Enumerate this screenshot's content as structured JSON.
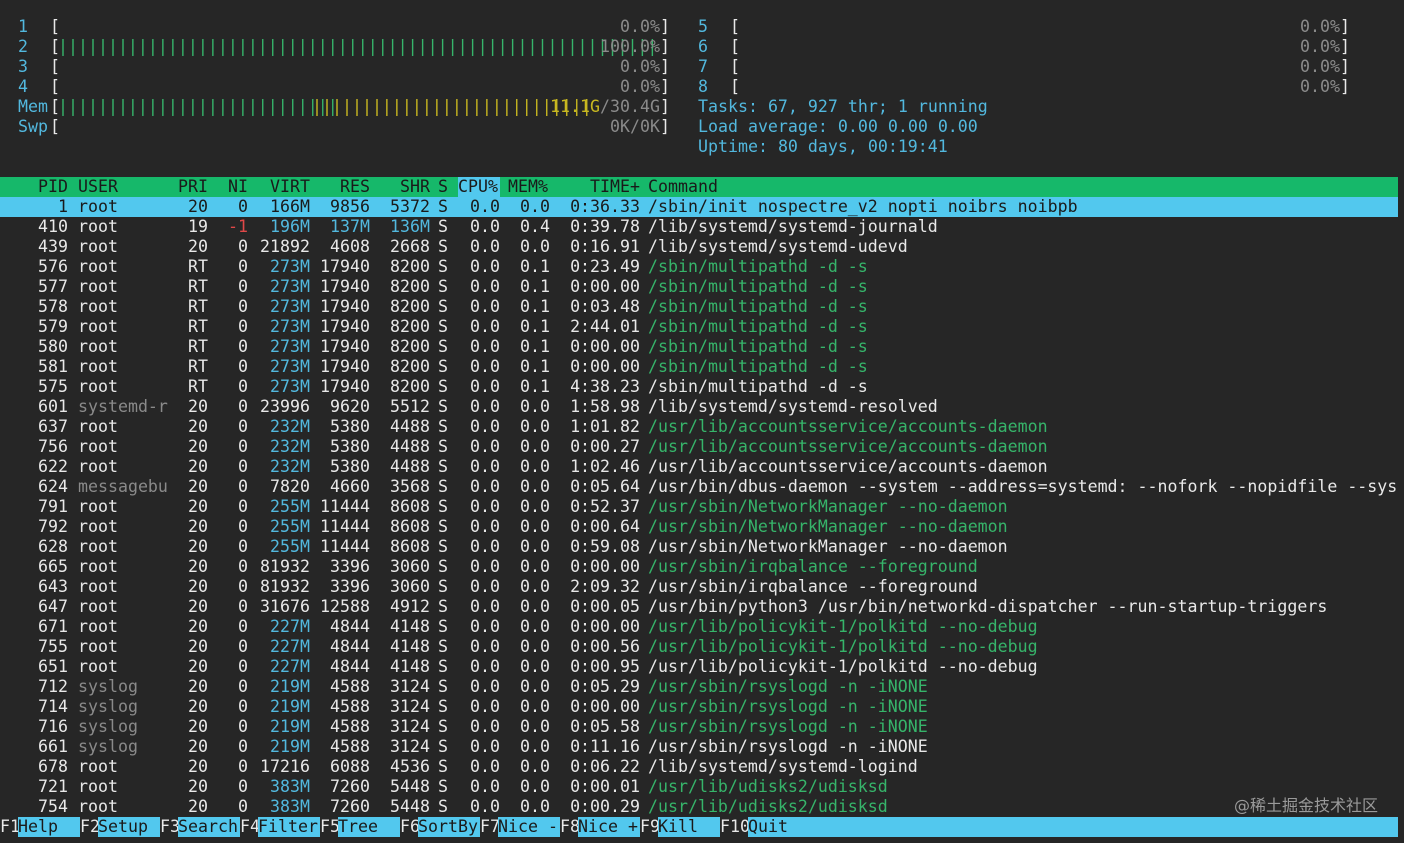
{
  "cpus_left": [
    {
      "num": "1",
      "bar": "",
      "pct": "0.0%"
    },
    {
      "num": "2",
      "bar": "||||||||||||||||||||||||||||||||||||||||||||||||||||||||||||",
      "pct": "100.0%"
    },
    {
      "num": "3",
      "bar": "",
      "pct": "0.0%"
    },
    {
      "num": "4",
      "bar": "",
      "pct": "0.0%"
    }
  ],
  "cpus_right": [
    {
      "num": "5",
      "bar": "",
      "pct": "0.0%"
    },
    {
      "num": "6",
      "bar": "",
      "pct": "0.0%"
    },
    {
      "num": "7",
      "bar": "",
      "pct": "0.0%"
    },
    {
      "num": "8",
      "bar": "",
      "pct": "0.0%"
    }
  ],
  "mem": {
    "label": "Mem",
    "bar_green": "||||||||||||||||||||||||||||",
    "bar_yellow": "||||||||||||||||||||||||||||",
    "used": "11.1G",
    "total": "/30.4G"
  },
  "swp": {
    "label": "Swp",
    "value": "0K/0K"
  },
  "tasks": {
    "label": "Tasks: ",
    "count": "67",
    "sep": ", ",
    "thr": "927",
    "thr_label": " thr; ",
    "running": "1",
    "running_label": " running"
  },
  "load": {
    "label": "Load average: ",
    "v1": "0.00",
    "v2": "0.00",
    "v3": "0.00"
  },
  "uptime": {
    "label": "Uptime: ",
    "value": "80 days, 00:19:41"
  },
  "header": {
    "pid": "PID",
    "user": "USER",
    "pri": "PRI",
    "ni": "NI",
    "virt": "VIRT",
    "res": "RES",
    "shr": "SHR",
    "s": "S",
    "cpu": "CPU%",
    "mem": "MEM%",
    "time": "TIME+",
    "command": "Command"
  },
  "processes": [
    {
      "pid": "1",
      "user": "root",
      "pri": "20",
      "ni": "0",
      "virt": "166M",
      "res": "9856",
      "shr": "5372",
      "s": "S",
      "cpu": "0.0",
      "mem": "0.0",
      "time": "0:36.33",
      "cmd": "/sbin/init nospectre_v2 nopti noibrs noibpb",
      "thread": false,
      "user_gray": false
    },
    {
      "pid": "410",
      "user": "root",
      "pri": "19",
      "ni": "-1",
      "virt": "196M",
      "res": "137M",
      "shr": "136M",
      "s": "S",
      "cpu": "0.0",
      "mem": "0.4",
      "time": "0:39.78",
      "cmd": "/lib/systemd/systemd-journald",
      "thread": false,
      "user_gray": false
    },
    {
      "pid": "439",
      "user": "root",
      "pri": "20",
      "ni": "0",
      "virt": "21892",
      "res": "4608",
      "shr": "2668",
      "s": "S",
      "cpu": "0.0",
      "mem": "0.0",
      "time": "0:16.91",
      "cmd": "/lib/systemd/systemd-udevd",
      "thread": false,
      "user_gray": false
    },
    {
      "pid": "576",
      "user": "root",
      "pri": "RT",
      "ni": "0",
      "virt": "273M",
      "res": "17940",
      "shr": "8200",
      "s": "S",
      "cpu": "0.0",
      "mem": "0.1",
      "time": "0:23.49",
      "cmd": "/sbin/multipathd -d -s",
      "thread": true,
      "user_gray": false
    },
    {
      "pid": "577",
      "user": "root",
      "pri": "RT",
      "ni": "0",
      "virt": "273M",
      "res": "17940",
      "shr": "8200",
      "s": "S",
      "cpu": "0.0",
      "mem": "0.1",
      "time": "0:00.00",
      "cmd": "/sbin/multipathd -d -s",
      "thread": true,
      "user_gray": false
    },
    {
      "pid": "578",
      "user": "root",
      "pri": "RT",
      "ni": "0",
      "virt": "273M",
      "res": "17940",
      "shr": "8200",
      "s": "S",
      "cpu": "0.0",
      "mem": "0.1",
      "time": "0:03.48",
      "cmd": "/sbin/multipathd -d -s",
      "thread": true,
      "user_gray": false
    },
    {
      "pid": "579",
      "user": "root",
      "pri": "RT",
      "ni": "0",
      "virt": "273M",
      "res": "17940",
      "shr": "8200",
      "s": "S",
      "cpu": "0.0",
      "mem": "0.1",
      "time": "2:44.01",
      "cmd": "/sbin/multipathd -d -s",
      "thread": true,
      "user_gray": false
    },
    {
      "pid": "580",
      "user": "root",
      "pri": "RT",
      "ni": "0",
      "virt": "273M",
      "res": "17940",
      "shr": "8200",
      "s": "S",
      "cpu": "0.0",
      "mem": "0.1",
      "time": "0:00.00",
      "cmd": "/sbin/multipathd -d -s",
      "thread": true,
      "user_gray": false
    },
    {
      "pid": "581",
      "user": "root",
      "pri": "RT",
      "ni": "0",
      "virt": "273M",
      "res": "17940",
      "shr": "8200",
      "s": "S",
      "cpu": "0.0",
      "mem": "0.1",
      "time": "0:00.00",
      "cmd": "/sbin/multipathd -d -s",
      "thread": true,
      "user_gray": false
    },
    {
      "pid": "575",
      "user": "root",
      "pri": "RT",
      "ni": "0",
      "virt": "273M",
      "res": "17940",
      "shr": "8200",
      "s": "S",
      "cpu": "0.0",
      "mem": "0.1",
      "time": "4:38.23",
      "cmd": "/sbin/multipathd -d -s",
      "thread": false,
      "user_gray": false
    },
    {
      "pid": "601",
      "user": "systemd-r",
      "pri": "20",
      "ni": "0",
      "virt": "23996",
      "res": "9620",
      "shr": "5512",
      "s": "S",
      "cpu": "0.0",
      "mem": "0.0",
      "time": "1:58.98",
      "cmd": "/lib/systemd/systemd-resolved",
      "thread": false,
      "user_gray": true
    },
    {
      "pid": "637",
      "user": "root",
      "pri": "20",
      "ni": "0",
      "virt": "232M",
      "res": "5380",
      "shr": "4488",
      "s": "S",
      "cpu": "0.0",
      "mem": "0.0",
      "time": "1:01.82",
      "cmd": "/usr/lib/accountsservice/accounts-daemon",
      "thread": true,
      "user_gray": false
    },
    {
      "pid": "756",
      "user": "root",
      "pri": "20",
      "ni": "0",
      "virt": "232M",
      "res": "5380",
      "shr": "4488",
      "s": "S",
      "cpu": "0.0",
      "mem": "0.0",
      "time": "0:00.27",
      "cmd": "/usr/lib/accountsservice/accounts-daemon",
      "thread": true,
      "user_gray": false
    },
    {
      "pid": "622",
      "user": "root",
      "pri": "20",
      "ni": "0",
      "virt": "232M",
      "res": "5380",
      "shr": "4488",
      "s": "S",
      "cpu": "0.0",
      "mem": "0.0",
      "time": "1:02.46",
      "cmd": "/usr/lib/accountsservice/accounts-daemon",
      "thread": false,
      "user_gray": false
    },
    {
      "pid": "624",
      "user": "messagebu",
      "pri": "20",
      "ni": "0",
      "virt": "7820",
      "res": "4660",
      "shr": "3568",
      "s": "S",
      "cpu": "0.0",
      "mem": "0.0",
      "time": "0:05.64",
      "cmd": "/usr/bin/dbus-daemon --system --address=systemd: --nofork --nopidfile --sys",
      "thread": false,
      "user_gray": true
    },
    {
      "pid": "791",
      "user": "root",
      "pri": "20",
      "ni": "0",
      "virt": "255M",
      "res": "11444",
      "shr": "8608",
      "s": "S",
      "cpu": "0.0",
      "mem": "0.0",
      "time": "0:52.37",
      "cmd": "/usr/sbin/NetworkManager --no-daemon",
      "thread": true,
      "user_gray": false
    },
    {
      "pid": "792",
      "user": "root",
      "pri": "20",
      "ni": "0",
      "virt": "255M",
      "res": "11444",
      "shr": "8608",
      "s": "S",
      "cpu": "0.0",
      "mem": "0.0",
      "time": "0:00.64",
      "cmd": "/usr/sbin/NetworkManager --no-daemon",
      "thread": true,
      "user_gray": false
    },
    {
      "pid": "628",
      "user": "root",
      "pri": "20",
      "ni": "0",
      "virt": "255M",
      "res": "11444",
      "shr": "8608",
      "s": "S",
      "cpu": "0.0",
      "mem": "0.0",
      "time": "0:59.08",
      "cmd": "/usr/sbin/NetworkManager --no-daemon",
      "thread": false,
      "user_gray": false
    },
    {
      "pid": "665",
      "user": "root",
      "pri": "20",
      "ni": "0",
      "virt": "81932",
      "res": "3396",
      "shr": "3060",
      "s": "S",
      "cpu": "0.0",
      "mem": "0.0",
      "time": "0:00.00",
      "cmd": "/usr/sbin/irqbalance --foreground",
      "thread": true,
      "user_gray": false
    },
    {
      "pid": "643",
      "user": "root",
      "pri": "20",
      "ni": "0",
      "virt": "81932",
      "res": "3396",
      "shr": "3060",
      "s": "S",
      "cpu": "0.0",
      "mem": "0.0",
      "time": "2:09.32",
      "cmd": "/usr/sbin/irqbalance --foreground",
      "thread": false,
      "user_gray": false
    },
    {
      "pid": "647",
      "user": "root",
      "pri": "20",
      "ni": "0",
      "virt": "31676",
      "res": "12588",
      "shr": "4912",
      "s": "S",
      "cpu": "0.0",
      "mem": "0.0",
      "time": "0:00.05",
      "cmd": "/usr/bin/python3 /usr/bin/networkd-dispatcher --run-startup-triggers",
      "thread": false,
      "user_gray": false
    },
    {
      "pid": "671",
      "user": "root",
      "pri": "20",
      "ni": "0",
      "virt": "227M",
      "res": "4844",
      "shr": "4148",
      "s": "S",
      "cpu": "0.0",
      "mem": "0.0",
      "time": "0:00.00",
      "cmd": "/usr/lib/policykit-1/polkitd --no-debug",
      "thread": true,
      "user_gray": false
    },
    {
      "pid": "755",
      "user": "root",
      "pri": "20",
      "ni": "0",
      "virt": "227M",
      "res": "4844",
      "shr": "4148",
      "s": "S",
      "cpu": "0.0",
      "mem": "0.0",
      "time": "0:00.56",
      "cmd": "/usr/lib/policykit-1/polkitd --no-debug",
      "thread": true,
      "user_gray": false
    },
    {
      "pid": "651",
      "user": "root",
      "pri": "20",
      "ni": "0",
      "virt": "227M",
      "res": "4844",
      "shr": "4148",
      "s": "S",
      "cpu": "0.0",
      "mem": "0.0",
      "time": "0:00.95",
      "cmd": "/usr/lib/policykit-1/polkitd --no-debug",
      "thread": false,
      "user_gray": false
    },
    {
      "pid": "712",
      "user": "syslog",
      "pri": "20",
      "ni": "0",
      "virt": "219M",
      "res": "4588",
      "shr": "3124",
      "s": "S",
      "cpu": "0.0",
      "mem": "0.0",
      "time": "0:05.29",
      "cmd": "/usr/sbin/rsyslogd -n -iNONE",
      "thread": true,
      "user_gray": true
    },
    {
      "pid": "714",
      "user": "syslog",
      "pri": "20",
      "ni": "0",
      "virt": "219M",
      "res": "4588",
      "shr": "3124",
      "s": "S",
      "cpu": "0.0",
      "mem": "0.0",
      "time": "0:00.00",
      "cmd": "/usr/sbin/rsyslogd -n -iNONE",
      "thread": true,
      "user_gray": true
    },
    {
      "pid": "716",
      "user": "syslog",
      "pri": "20",
      "ni": "0",
      "virt": "219M",
      "res": "4588",
      "shr": "3124",
      "s": "S",
      "cpu": "0.0",
      "mem": "0.0",
      "time": "0:05.58",
      "cmd": "/usr/sbin/rsyslogd -n -iNONE",
      "thread": true,
      "user_gray": true
    },
    {
      "pid": "661",
      "user": "syslog",
      "pri": "20",
      "ni": "0",
      "virt": "219M",
      "res": "4588",
      "shr": "3124",
      "s": "S",
      "cpu": "0.0",
      "mem": "0.0",
      "time": "0:11.16",
      "cmd": "/usr/sbin/rsyslogd -n -iNONE",
      "thread": false,
      "user_gray": true
    },
    {
      "pid": "678",
      "user": "root",
      "pri": "20",
      "ni": "0",
      "virt": "17216",
      "res": "6088",
      "shr": "4536",
      "s": "S",
      "cpu": "0.0",
      "mem": "0.0",
      "time": "0:06.22",
      "cmd": "/lib/systemd/systemd-logind",
      "thread": false,
      "user_gray": false
    },
    {
      "pid": "721",
      "user": "root",
      "pri": "20",
      "ni": "0",
      "virt": "383M",
      "res": "7260",
      "shr": "5448",
      "s": "S",
      "cpu": "0.0",
      "mem": "0.0",
      "time": "0:00.01",
      "cmd": "/usr/lib/udisks2/udisksd",
      "thread": true,
      "user_gray": false
    },
    {
      "pid": "754",
      "user": "root",
      "pri": "20",
      "ni": "0",
      "virt": "383M",
      "res": "7260",
      "shr": "5448",
      "s": "S",
      "cpu": "0.0",
      "mem": "0.0",
      "time": "0:00.29",
      "cmd": "/usr/lib/udisks2/udisksd",
      "thread": true,
      "user_gray": false
    }
  ],
  "fkeys": [
    {
      "key": "F1",
      "label": "Help"
    },
    {
      "key": "F2",
      "label": "Setup"
    },
    {
      "key": "F3",
      "label": "Search"
    },
    {
      "key": "F4",
      "label": "Filter"
    },
    {
      "key": "F5",
      "label": "Tree"
    },
    {
      "key": "F6",
      "label": "SortBy"
    },
    {
      "key": "F7",
      "label": "Nice -"
    },
    {
      "key": "F8",
      "label": "Nice +"
    },
    {
      "key": "F9",
      "label": "Kill"
    },
    {
      "key": "F10",
      "label": "Quit"
    }
  ],
  "watermark": "@稀土掘金技术社区",
  "colors": {
    "bg": "#262626",
    "header": "#16b86a",
    "selection": "#52c8ee",
    "thread": "#36b46a",
    "label": "#52b8de",
    "mem_used": "#c8b820"
  }
}
